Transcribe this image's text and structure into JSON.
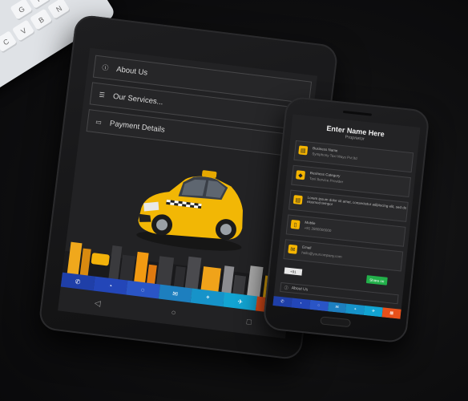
{
  "keyboard": {
    "keys": [
      "V",
      "B",
      "N",
      "G",
      "H",
      "C"
    ]
  },
  "tablet": {
    "menu": [
      {
        "label": "About Us",
        "icon": "info-icon",
        "has_chevron": false
      },
      {
        "label": "Our Services...",
        "icon": "list-icon",
        "has_chevron": true
      },
      {
        "label": "Payment Details",
        "icon": "card-icon",
        "has_chevron": true
      }
    ],
    "bottom_bar": [
      {
        "icon": "phone-icon",
        "glyph": "✆",
        "color": "#1f3fa8"
      },
      {
        "icon": "whatsapp-icon",
        "glyph": "◔",
        "color": "#2346b8"
      },
      {
        "icon": "chat-icon",
        "glyph": "◌",
        "color": "#2a55c6"
      },
      {
        "icon": "email-icon",
        "glyph": "✉",
        "color": "#1d7fbf"
      },
      {
        "icon": "location-icon",
        "glyph": "⌖",
        "color": "#1693c9"
      },
      {
        "icon": "share-icon",
        "glyph": "✈",
        "color": "#12a4d2"
      },
      {
        "icon": "other-icon",
        "glyph": "▦",
        "color": "#e8501a"
      }
    ],
    "nav": [
      {
        "icon": "back-icon",
        "glyph": "◁"
      },
      {
        "icon": "home-icon",
        "glyph": "○"
      },
      {
        "icon": "recents-icon",
        "glyph": "□"
      }
    ]
  },
  "phone": {
    "title": "Enter Name Here",
    "subtitle": "Proprietor",
    "cards": [
      {
        "icon": "building-icon",
        "line1": "Business Name",
        "line2": "Symphony Taxi Ways Pvt.ltd"
      },
      {
        "icon": "tag-icon",
        "line1": "Business Category",
        "line2": "Taxi Service Provider"
      },
      {
        "icon": "document-icon",
        "line1": "Lorem ipsum dolor sit amet, consectetur adipiscing elit, sed do eiusmod tempor",
        "line2": ""
      },
      {
        "icon": "mobile-icon",
        "line1": "Mobile",
        "line2": "+91 2800000000"
      },
      {
        "icon": "email-icon",
        "line1": "Email",
        "line2": "hello@yourcompany.com"
      }
    ],
    "country_code": "+91",
    "phone_placeholder": "",
    "whatsapp_button": "Share on",
    "about_label": "About Us",
    "bottom_bar": [
      {
        "icon": "phone-icon",
        "glyph": "✆",
        "color": "#1f3fa8"
      },
      {
        "icon": "whatsapp-icon",
        "glyph": "◔",
        "color": "#2346b8"
      },
      {
        "icon": "chat-icon",
        "glyph": "◌",
        "color": "#2a55c6"
      },
      {
        "icon": "email-icon",
        "glyph": "✉",
        "color": "#1d7fbf"
      },
      {
        "icon": "location-icon",
        "glyph": "⌖",
        "color": "#1693c9"
      },
      {
        "icon": "share-icon",
        "glyph": "✈",
        "color": "#12a4d2"
      },
      {
        "icon": "other-icon",
        "glyph": "▦",
        "color": "#e8501a"
      }
    ]
  }
}
